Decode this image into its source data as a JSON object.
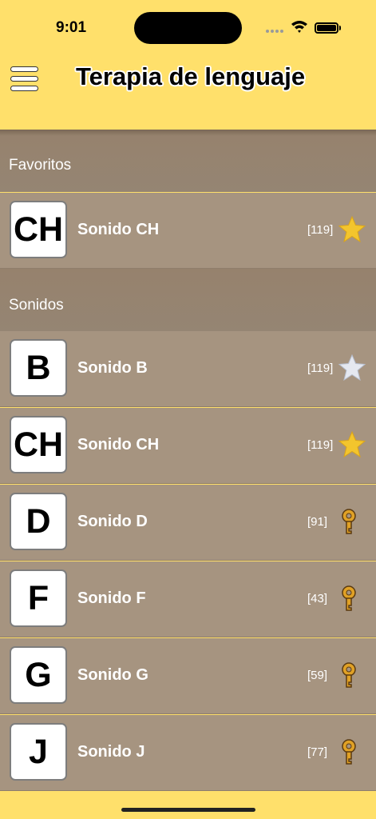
{
  "status_bar": {
    "time": "9:01"
  },
  "header": {
    "title": "Terapia de lenguaje"
  },
  "sections": [
    {
      "title": "Favoritos",
      "items": [
        {
          "letter": "CH",
          "label": "Sonido CH",
          "count": "[119]",
          "icon": "star-filled-icon",
          "color": "#F3C52D"
        }
      ]
    },
    {
      "title": "Sonidos",
      "items": [
        {
          "letter": "B",
          "label": "Sonido B",
          "count": "[119]",
          "icon": "star-outline-icon",
          "color": "#E5E8F0"
        },
        {
          "letter": "CH",
          "label": "Sonido CH",
          "count": "[119]",
          "icon": "star-filled-icon",
          "color": "#F3C52D"
        },
        {
          "letter": "D",
          "label": "Sonido D",
          "count": "[91]",
          "icon": "key-icon",
          "color": "#E0A126"
        },
        {
          "letter": "F",
          "label": "Sonido F",
          "count": "[43]",
          "icon": "key-icon",
          "color": "#E0A126"
        },
        {
          "letter": "G",
          "label": "Sonido G",
          "count": "[59]",
          "icon": "key-icon",
          "color": "#E0A126"
        },
        {
          "letter": "J",
          "label": "Sonido J",
          "count": "[77]",
          "icon": "key-icon",
          "color": "#E0A126"
        }
      ]
    }
  ],
  "colors": {
    "header_bg": "#FFE06B",
    "row_bg": "#A69480",
    "section_bg": "#96826D"
  }
}
